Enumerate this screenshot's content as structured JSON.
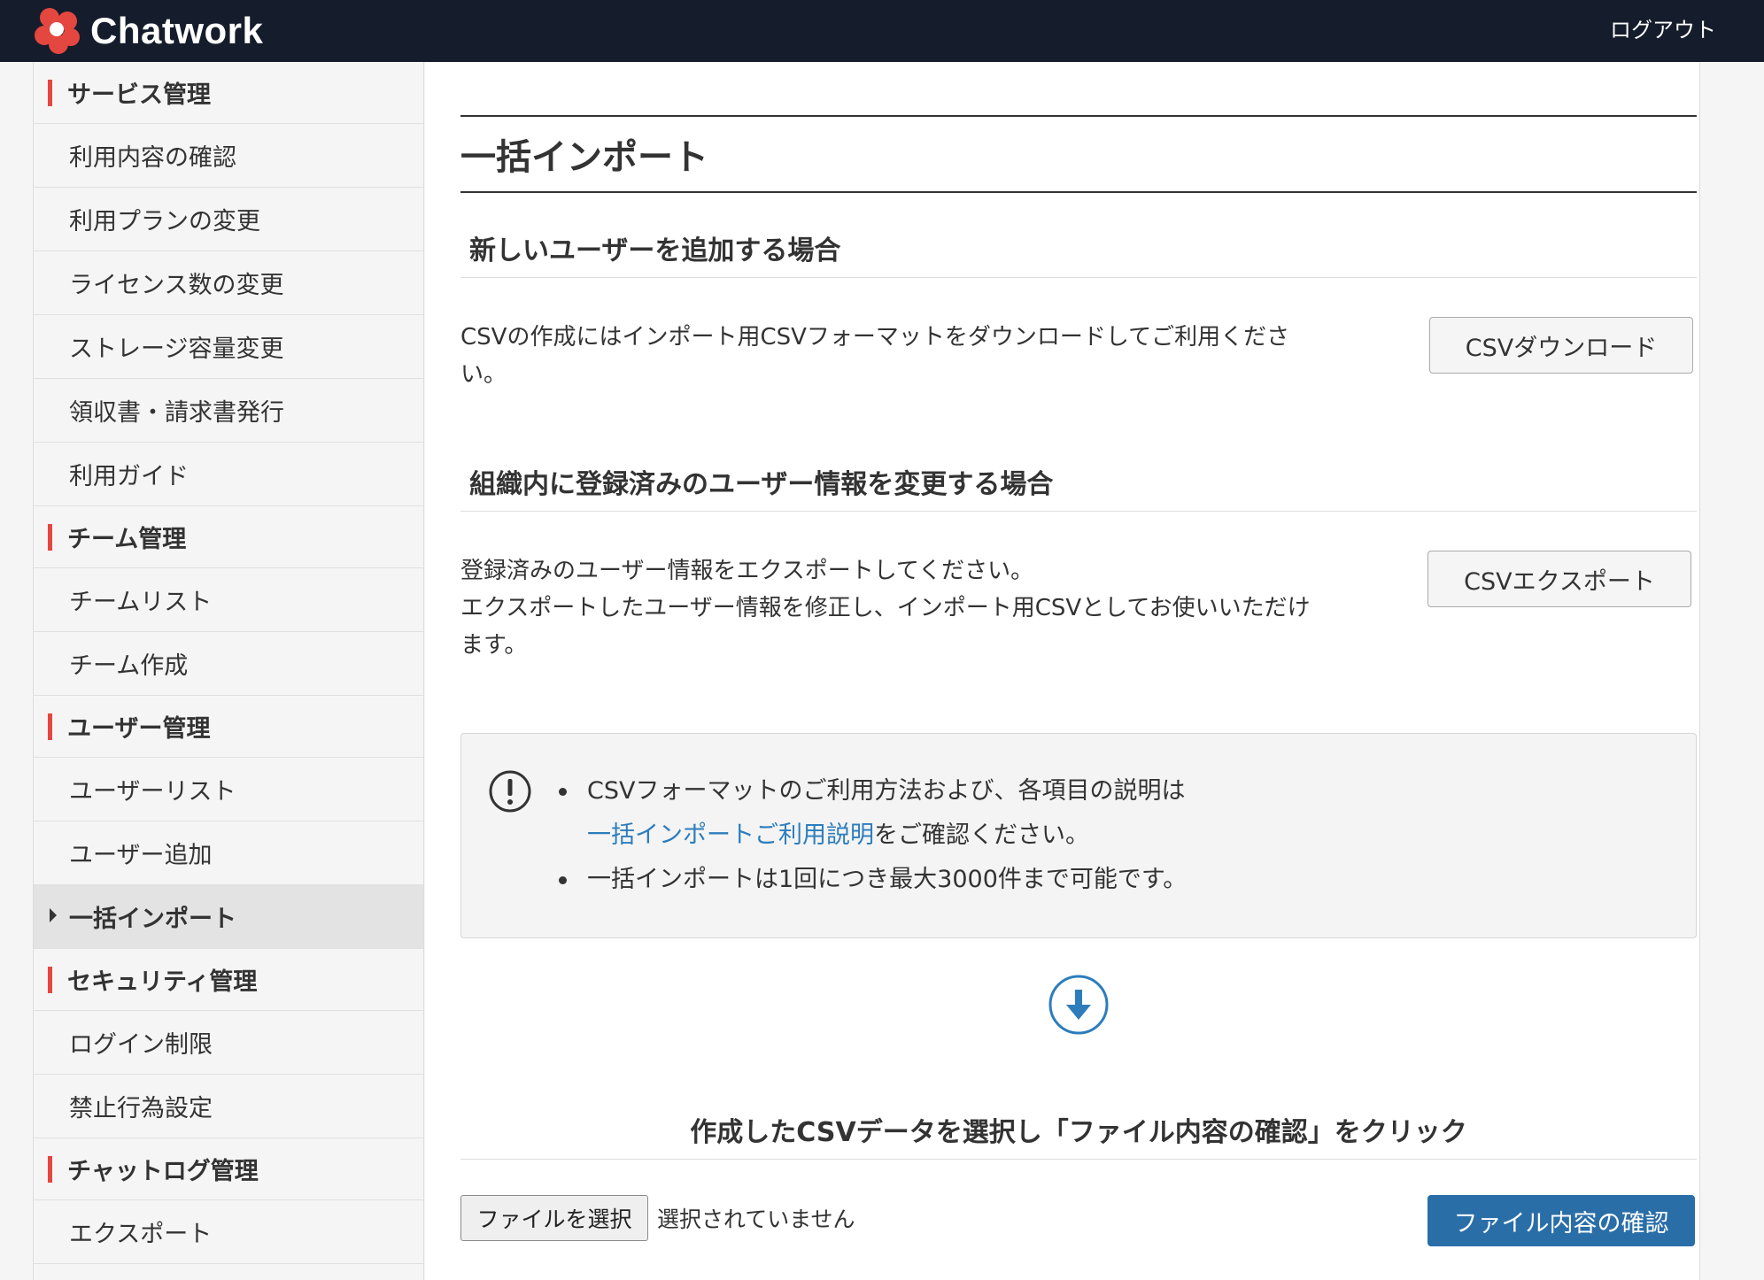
{
  "header": {
    "brand": "Chatwork",
    "logout_label": "ログアウト"
  },
  "sidebar": {
    "groups": [
      {
        "title": "サービス管理",
        "items": [
          "利用内容の確認",
          "利用プランの変更",
          "ライセンス数の変更",
          "ストレージ容量変更",
          "領収書・請求書発行",
          "利用ガイド"
        ]
      },
      {
        "title": "チーム管理",
        "items": [
          "チームリスト",
          "チーム作成"
        ]
      },
      {
        "title": "ユーザー管理",
        "items": [
          "ユーザーリスト",
          "ユーザー追加",
          "一括インポート"
        ]
      },
      {
        "title": "セキュリティ管理",
        "items": [
          "ログイン制限",
          "禁止行為設定"
        ]
      },
      {
        "title": "チャットログ管理",
        "items": [
          "エクスポート"
        ]
      }
    ],
    "active_item": "一括インポート"
  },
  "main": {
    "title": "一括インポート",
    "new_users": {
      "heading": "新しいユーザーを追加する場合",
      "desc_line1": "CSVの作成にはインポート用CSVフォーマットをダウンロードしてご利用くださ",
      "desc_line2": "い。",
      "button_label": "CSVダウンロード"
    },
    "update_users": {
      "heading": "組織内に登録済みのユーザー情報を変更する場合",
      "desc_line1": "登録済みのユーザー情報をエクスポートしてください。",
      "desc_line2": "エクスポートしたユーザー情報を修正し、インポート用CSVとしてお使いいただけ",
      "desc_line3": "ます。",
      "button_label": "CSVエクスポート"
    },
    "notice": {
      "item1_text": "CSVフォーマットのご利用方法および、各項目の説明は",
      "item1_link": "一括インポートご利用説明",
      "item1_suffix": "をご確認ください。",
      "item2_text": "一括インポートは1回につき最大3000件まで可能です。"
    },
    "upload": {
      "heading": "作成したCSVデータを選択し「ファイル内容の確認」をクリック",
      "file_button_label": "ファイルを選択",
      "file_status": "選択されていません",
      "confirm_button_label": "ファイル内容の確認"
    }
  },
  "colors": {
    "header_bg": "#151c2b",
    "accent_red": "#e4473f",
    "link_blue": "#2d7dbc",
    "primary_button": "#2a6ea8"
  },
  "icons": {
    "logo": "chatwork-logo-icon",
    "notice": "exclamation-circle-icon",
    "arrow": "arrow-down-circle-icon"
  }
}
